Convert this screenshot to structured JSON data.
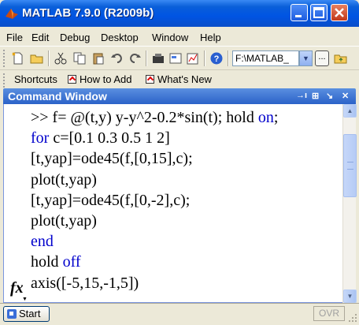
{
  "window": {
    "title": "MATLAB  7.9.0 (R2009b)"
  },
  "menu": [
    "File",
    "Edit",
    "Debug",
    "Desktop",
    "Window",
    "Help"
  ],
  "toolbar": {
    "current_folder": "F:\\MATLAB_"
  },
  "shortcuts": {
    "label": "Shortcuts",
    "how_to_add": "How to Add",
    "whats_new": "What's New"
  },
  "command_window": {
    "title": "Command Window",
    "lines": [
      [
        {
          "t": ">> f= @(t,y) y-y^2-0.2*sin(t); hold "
        },
        {
          "t": "on",
          "kw": true
        },
        {
          "t": ";"
        }
      ],
      [
        {
          "t": "for",
          "kw": true
        },
        {
          "t": " c=[0.1 0.3 0.5 1 2]"
        }
      ],
      [
        {
          "t": "[t,yap]=ode45(f,[0,15],c);"
        }
      ],
      [
        {
          "t": "plot(t,yap)"
        }
      ],
      [
        {
          "t": "[t,yap]=ode45(f,[0,-2],c);"
        }
      ],
      [
        {
          "t": "plot(t,yap)"
        }
      ],
      [
        {
          "t": "end",
          "kw": true
        }
      ],
      [
        {
          "t": "hold "
        },
        {
          "t": "off",
          "kw": true
        }
      ],
      [
        {
          "t": "axis([-5,15,-1,5])"
        }
      ]
    ],
    "prompt_icon": "fx"
  },
  "status": {
    "start_label": "Start",
    "ovr": "OVR"
  },
  "colors": {
    "keyword": "#0000cc",
    "titlebar": "#0054e3"
  }
}
